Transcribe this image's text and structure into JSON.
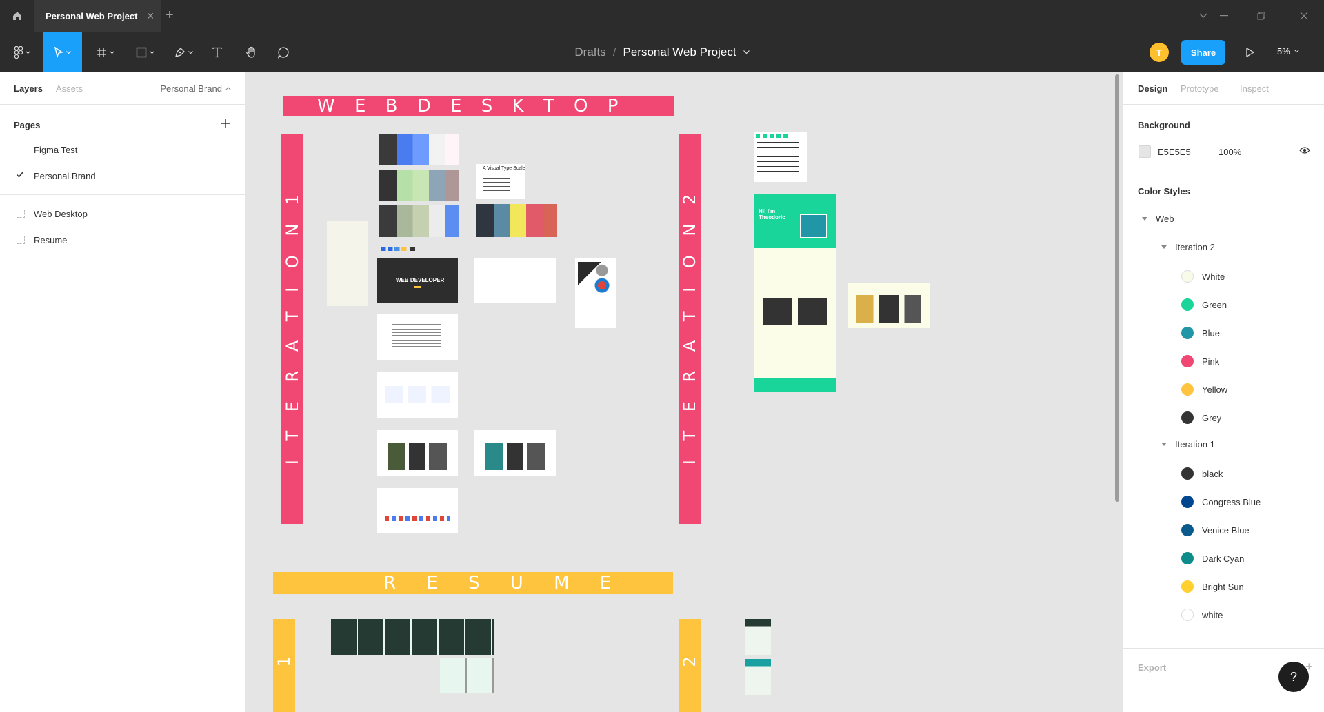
{
  "titlebar": {
    "tab_title": "Personal Web Project",
    "tab_close": "✕",
    "new_tab": "+"
  },
  "toolbar": {
    "crumb_drafts": "Drafts",
    "crumb_sep": "/",
    "file_name": "Personal Web Project",
    "avatar_initial": "T",
    "share_label": "Share",
    "zoom": "5%"
  },
  "left_panel": {
    "tabs": [
      "Layers",
      "Assets"
    ],
    "page_selector": "Personal Brand",
    "pages_title": "Pages",
    "pages": [
      "Figma Test",
      "Personal Brand"
    ],
    "layers": [
      "Web Desktop",
      "Resume"
    ]
  },
  "right_panel": {
    "tabs": [
      "Design",
      "Prototype",
      "Inspect"
    ],
    "background_title": "Background",
    "background_hex": "E5E5E5",
    "background_opacity": "100%",
    "color_styles_title": "Color Styles",
    "group_web": "Web",
    "group_iter2": "Iteration 2",
    "iteration2": [
      {
        "name": "White",
        "color": "#f8fbe8"
      },
      {
        "name": "Green",
        "color": "#19d59a"
      },
      {
        "name": "Blue",
        "color": "#2196a7"
      },
      {
        "name": "Pink",
        "color": "#f04773"
      },
      {
        "name": "Yellow",
        "color": "#ffc43d"
      },
      {
        "name": "Grey",
        "color": "#343434"
      }
    ],
    "group_iter1": "Iteration 1",
    "iteration1": [
      {
        "name": "black",
        "color": "#333333"
      },
      {
        "name": "Congress Blue",
        "color": "#00478f"
      },
      {
        "name": "Venice Blue",
        "color": "#0a5a8c"
      },
      {
        "name": "Dark Cyan",
        "color": "#0e8c8c"
      },
      {
        "name": "Bright Sun",
        "color": "#ffd02e"
      },
      {
        "name": "white",
        "color": "#ffffff"
      }
    ],
    "export_title": "Export",
    "help": "?"
  },
  "canvas": {
    "web_desktop_banner": "W E B   D E S K T O P",
    "iteration1_banner": "I T E R A T I O N   1",
    "iteration2_banner": "I T E R A T I O N   2",
    "resume_banner": "R E S U M E",
    "resume1_label": "1",
    "resume2_label": "2",
    "type_scale_label": "A Visual Type Scale",
    "web_developer_label": "WEB DEVELOPER",
    "hero_label": "Hi! I'm Theodoric"
  }
}
